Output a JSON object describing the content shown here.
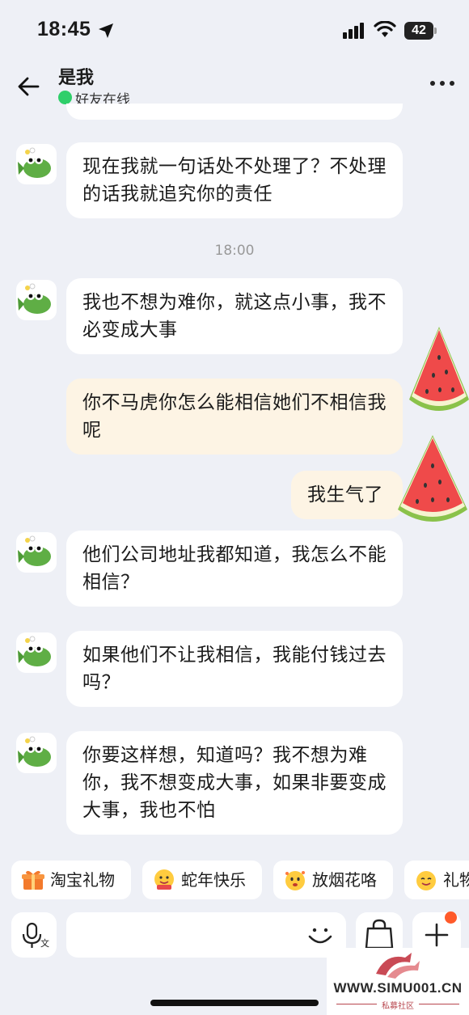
{
  "status_bar": {
    "time": "18:45",
    "battery": "42"
  },
  "header": {
    "name": "是我",
    "status": "好友在线"
  },
  "messages": [
    {
      "side": "in",
      "text": "现在我就一句话处不处理了？不处理的话我就追究你的责任"
    },
    {
      "side": "in",
      "text": "我也不想为难你，就这点小事，我不必变成大事"
    },
    {
      "side": "out",
      "text": "你不马虎你怎么能相信她们不相信我呢"
    },
    {
      "side": "out",
      "text": "我生气了"
    },
    {
      "side": "in",
      "text": "他们公司地址我都知道，我怎么不能相信？"
    },
    {
      "side": "in",
      "text": "如果他们不让我相信，我能付钱过去吗？"
    },
    {
      "side": "in",
      "text": "你要这样想，知道吗？我不想为难你，我不想变成大事，如果非要变成大事，我也不怕"
    }
  ],
  "timestamp": "18:00",
  "quick_actions": [
    {
      "label": "淘宝礼物",
      "icon": "gift-icon"
    },
    {
      "label": "蛇年快乐",
      "icon": "snake-emoji-icon"
    },
    {
      "label": "放烟花咯",
      "icon": "fireworks-emoji-icon"
    },
    {
      "label": "礼物",
      "icon": "gift-emoji-icon"
    }
  ],
  "input": {
    "placeholder": ""
  },
  "watermark": {
    "url": "WWW.SIMU001.CN",
    "sub": "私募社区"
  },
  "colors": {
    "online": "#2fcf6a",
    "incoming_bubble": "#ffffff",
    "outgoing_bubble": "#fdf4e4",
    "badge": "#ff5a2a"
  }
}
